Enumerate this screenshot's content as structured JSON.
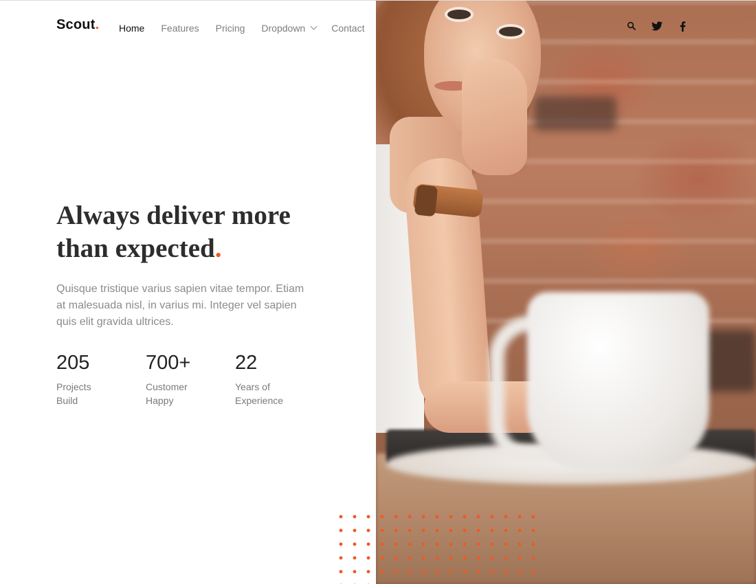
{
  "brand": {
    "name": "Scout",
    "dot": "."
  },
  "nav": {
    "items": [
      {
        "label": "Home",
        "active": true
      },
      {
        "label": "Features"
      },
      {
        "label": "Pricing"
      },
      {
        "label": "Dropdown",
        "has_menu": true
      },
      {
        "label": "Contact"
      }
    ]
  },
  "social": {
    "icons": [
      "search-icon",
      "twitter-icon",
      "facebook-icon"
    ]
  },
  "hero": {
    "headline_line1": "Always deliver more",
    "headline_line2": "than expected",
    "headline_dot": ".",
    "lead": "Quisque tristique varius sapien vitae tempor. Etiam at malesuada nisl, in varius mi. Integer vel sapien quis elit gravida ultrices."
  },
  "stats": [
    {
      "value": "205",
      "label_line1": "Projects",
      "label_line2": "Build"
    },
    {
      "value": "700+",
      "label_line1": "Customer",
      "label_line2": "Happy"
    },
    {
      "value": "22",
      "label_line1": "Years of",
      "label_line2": "Experience"
    }
  ],
  "colors": {
    "accent": "#ee5a24",
    "text": "#2d2d2d",
    "muted": "#8b8b8b"
  }
}
